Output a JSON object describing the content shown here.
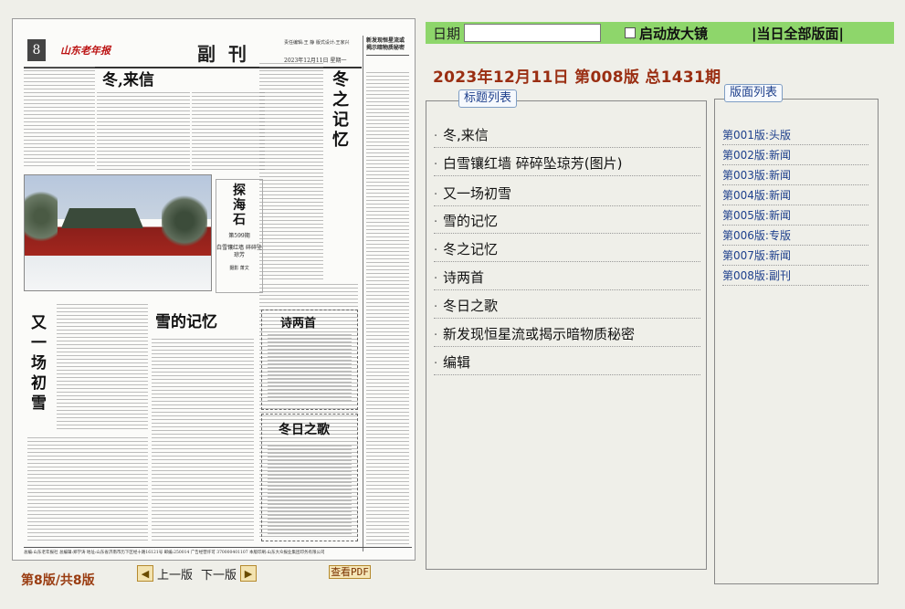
{
  "paper": {
    "page_number": "8",
    "logo_text": "山东老年报",
    "section_name": "副刊",
    "editor_line": "责任编辑:王 静  版式设计:王家兴",
    "date_line": "2023年12月11日  星期一",
    "side_column_title": "新发现恒星流或揭示暗物质秘密",
    "headlines": {
      "dong_lai_xin": "冬,来信",
      "dong_zhi_ji_yi": "冬之记忆",
      "tan_hai_shi": "探海石",
      "you_yi_chang_chu_xue": "又一场初雪",
      "xue_de_ji_yi": "雪的记忆",
      "shi_liang_shou": "诗两首",
      "dong_ri_zhi_ge": "冬日之歌"
    },
    "column_box": {
      "issue": "第599期",
      "caption": "白雪镶红墙 碎碎坠琼芳",
      "credit": "摄影 萧文"
    },
    "footer_text": "总编:山东老年报社  总编辑:郑学涛  地址:山东省济南市历下区经十路16121号  邮编:250014  广告经营许可 370000401107  本版印刷:山东大众报业集团印务有限公司"
  },
  "page_indicator": "第8版/共8版",
  "nav": {
    "prev_label": "上一版",
    "next_label": "下一版",
    "prev_icon": "left-arrow-icon",
    "next_icon": "right-arrow-icon"
  },
  "pdf_link_label": "查看PDF",
  "toolbar": {
    "date_label": "日期",
    "date_value": "",
    "magnifier_label": "启动放大镜",
    "all_pages_label": "|当日全部版面|"
  },
  "issue_title": "2023年12月11日 第008版  总1431期",
  "titles_tab_label": "标题列表",
  "titles": [
    "冬,来信",
    "白雪镶红墙  碎碎坠琼芳(图片)",
    "又一场初雪",
    "雪的记忆",
    "冬之记忆",
    "诗两首",
    "冬日之歌",
    "新发现恒星流或揭示暗物质秘密",
    "编辑"
  ],
  "pages_tab_label": "版面列表",
  "pages": [
    "第001版:头版",
    "第002版:新闻",
    "第003版:新闻",
    "第004版:新闻",
    "第005版:新闻",
    "第006版:专版",
    "第007版:新闻",
    "第008版:副刊"
  ],
  "colors": {
    "toolbar_bg": "#8ed66b",
    "issue_title": "#9a2e12",
    "link_blue": "#1d3f8c"
  }
}
